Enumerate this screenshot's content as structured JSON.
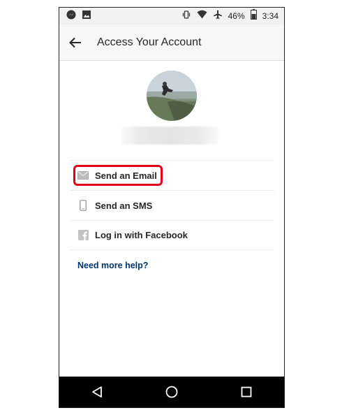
{
  "status_bar": {
    "battery_percent": "46%",
    "time": "3:34",
    "icons": [
      "messenger-icon",
      "image-icon",
      "vibrate-icon",
      "wifi-icon",
      "airplane-icon",
      "battery-icon"
    ]
  },
  "header": {
    "title": "Access Your Account"
  },
  "options": [
    {
      "label": "Send an Email",
      "icon": "mail-icon"
    },
    {
      "label": "Send an SMS",
      "icon": "phone-icon"
    },
    {
      "label": "Log in with Facebook",
      "icon": "facebook-icon"
    }
  ],
  "help_link": "Need more help?",
  "colors": {
    "accent": "#003569",
    "highlight": "#e3001b",
    "nav_bar": "#000000"
  }
}
